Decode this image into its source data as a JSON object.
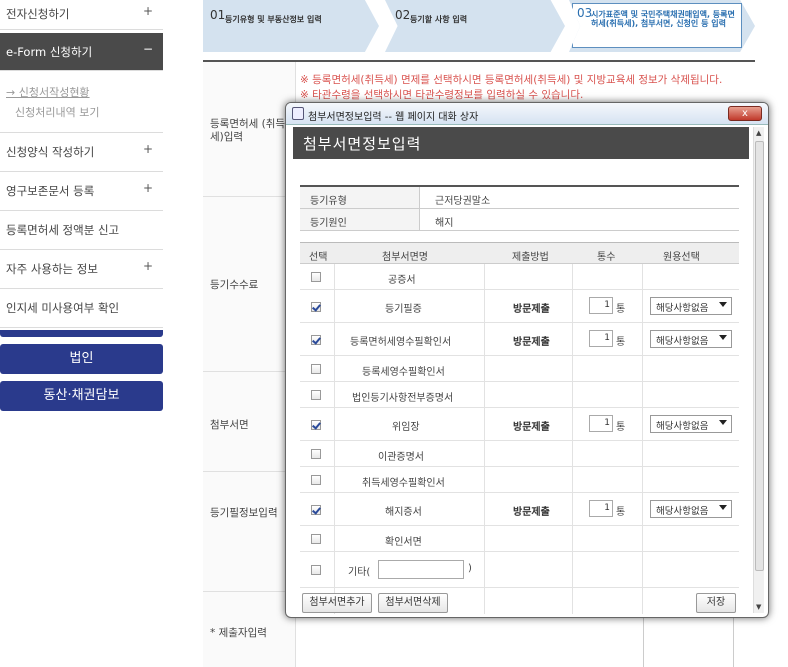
{
  "sidebar": {
    "items": [
      {
        "label": "전자신청하기",
        "toggle": "+"
      },
      {
        "label": "e-Form 신청하기",
        "toggle": "−"
      },
      {
        "label": "신청양식 작성하기",
        "toggle": "+"
      },
      {
        "label": "영구보존문서 등록",
        "toggle": "+"
      },
      {
        "label": "등록면허세 정액분 신고",
        "toggle": ""
      },
      {
        "label": "자주 사용하는 정보",
        "toggle": "+"
      },
      {
        "label": "인지세 미사용여부 확인",
        "toggle": ""
      }
    ],
    "subitems": [
      "→ 신청서작성현황",
      "신청처리내역 보기"
    ],
    "buttons": [
      "법인",
      "동산·채권담보"
    ]
  },
  "steps": [
    {
      "num": "01",
      "text": "등기유형 및 부동산정보 입력"
    },
    {
      "num": "02",
      "text": "등기할 사항 입력"
    },
    {
      "num": "03",
      "text": "시가표준액 및 국민주택채권매입액, 등록면허세(취득세), 첨부서면, 신청인 등 입력"
    }
  ],
  "form": {
    "row_labels": [
      "등록면허세 (취득세)입력",
      "등기수수료",
      "첨부서면",
      "등기필정보입력",
      "* 제출자입력"
    ],
    "notices": [
      "※ 등록면허세(취득세) 면제를 선택하시면 등록면허세(취득세) 및 지방교육세 정보가 삭제됩니다.",
      "※ 타관수령을 선택하시면 타관수령정보를 입력하실 수 있습니다."
    ]
  },
  "modal": {
    "window_title": "첨부서면정보입력 -- 웹 페이지 대화 상자",
    "close_label": "x",
    "header": "첨부서면정보입력",
    "info": [
      {
        "key": "등기유형",
        "value": "근저당권말소"
      },
      {
        "key": "등기원인",
        "value": "해지"
      }
    ],
    "columns": [
      "선택",
      "첨부서면명",
      "제출방법",
      "통수",
      "원용선택"
    ],
    "rows": [
      {
        "checked": false,
        "name": "공증서",
        "method": "",
        "count": "",
        "unit": "",
        "select": ""
      },
      {
        "checked": true,
        "name": "등기필증",
        "method": "방문제출",
        "count": "1",
        "unit": "통",
        "select": "해당사항없음"
      },
      {
        "checked": true,
        "name": "등록면허세영수필확인서",
        "method": "방문제출",
        "count": "1",
        "unit": "통",
        "select": "해당사항없음"
      },
      {
        "checked": false,
        "name": "등록세영수필확인서",
        "method": "",
        "count": "",
        "unit": "",
        "select": ""
      },
      {
        "checked": false,
        "name": "법인등기사항전부증명서",
        "method": "",
        "count": "",
        "unit": "",
        "select": ""
      },
      {
        "checked": true,
        "name": "위임장",
        "method": "방문제출",
        "count": "1",
        "unit": "통",
        "select": "해당사항없음"
      },
      {
        "checked": false,
        "name": "이관증명서",
        "method": "",
        "count": "",
        "unit": "",
        "select": ""
      },
      {
        "checked": false,
        "name": "취득세영수필확인서",
        "method": "",
        "count": "",
        "unit": "",
        "select": ""
      },
      {
        "checked": true,
        "name": "해지증서",
        "method": "방문제출",
        "count": "1",
        "unit": "통",
        "select": "해당사항없음"
      },
      {
        "checked": false,
        "name": "확인서면",
        "method": "",
        "count": "",
        "unit": "",
        "select": ""
      }
    ],
    "etc": {
      "label": "기타(",
      "close": ")",
      "value": ""
    },
    "buttons": {
      "add": "첨부서면추가",
      "delete": "첨부서면삭제",
      "save": "저장"
    }
  }
}
